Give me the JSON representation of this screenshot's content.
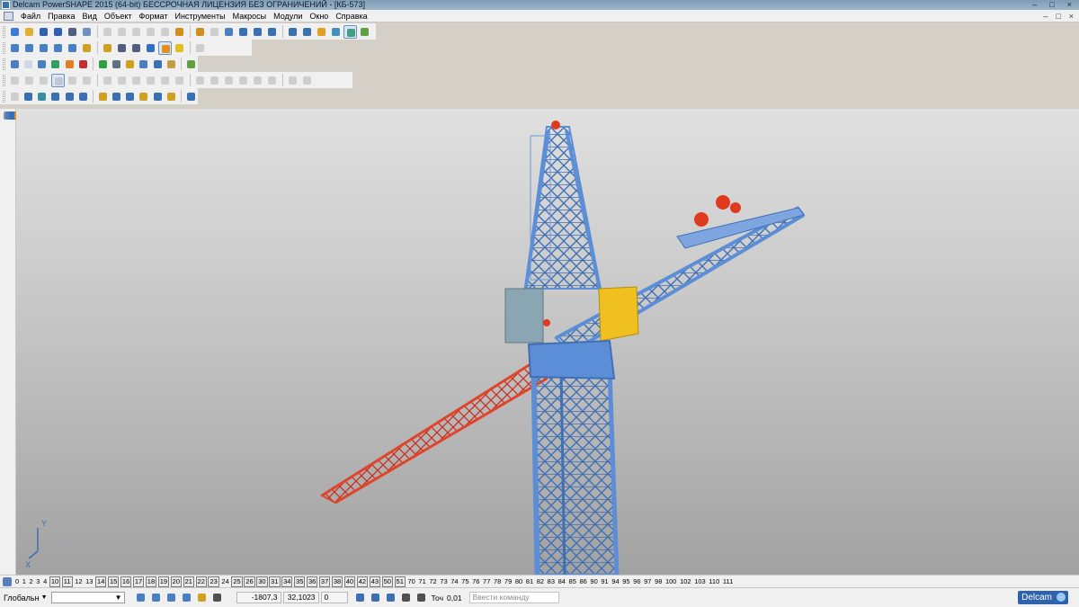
{
  "window": {
    "title": "Delcam PowerSHAPE 2015 (64-bit) БЕССРОЧНАЯ ЛИЦЕНЗИЯ БЕЗ ОГРАНИЧЕНИЙ - [КБ-573]",
    "controls": [
      "–",
      "□",
      "×"
    ],
    "mdi_controls": [
      "–",
      "□",
      "×"
    ]
  },
  "menu": [
    "Файл",
    "Правка",
    "Вид",
    "Объект",
    "Формат",
    "Инструменты",
    "Макросы",
    "Модули",
    "Окно",
    "Справка"
  ],
  "toolbars": {
    "row1": [
      {
        "icon": "new-model-icon",
        "color": "#3b7bd6"
      },
      {
        "icon": "open-icon",
        "color": "#e0b030"
      },
      {
        "icon": "save-icon",
        "color": "#3060b0"
      },
      {
        "icon": "save-as-icon",
        "color": "#3060b0"
      },
      {
        "icon": "print-icon",
        "color": "#506080"
      },
      {
        "icon": "undo-history-icon",
        "color": "#7090c0"
      },
      {
        "icon": "cut-icon",
        "color": "#909090",
        "dim": true
      },
      {
        "icon": "copy-icon",
        "color": "#909090",
        "dim": true
      },
      {
        "icon": "paste-icon",
        "color": "#909090",
        "dim": true
      },
      {
        "icon": "edit-icon",
        "color": "#909090",
        "dim": true
      },
      {
        "icon": "delete-icon",
        "color": "#909090",
        "dim": true
      },
      {
        "icon": "undo-icon",
        "color": "#d09020"
      },
      {
        "icon": "redo-icon",
        "color": "#d09020"
      },
      {
        "icon": "measure-icon",
        "color": "#909090",
        "dim": true
      },
      {
        "icon": "select-icon",
        "color": "#4a7fc0"
      },
      {
        "icon": "line-icon",
        "color": "#3a6fb0"
      },
      {
        "icon": "arc-icon",
        "color": "#3a6fb0"
      },
      {
        "icon": "circle-icon",
        "color": "#3a6fb0"
      },
      {
        "icon": "curve-icon",
        "color": "#3a6fb0"
      },
      {
        "icon": "text-icon",
        "color": "#3a6fb0"
      },
      {
        "icon": "surface-icon",
        "color": "#e0a020"
      },
      {
        "icon": "solid-icon",
        "color": "#4090c0"
      },
      {
        "icon": "shaded-icon",
        "color": "#40a080",
        "selected": true
      },
      {
        "icon": "tools-icon",
        "color": "#60a040"
      }
    ],
    "row2": [
      {
        "icon": "view-top-icon",
        "color": "#4a7fc0"
      },
      {
        "icon": "view-front-icon",
        "color": "#4a7fc0"
      },
      {
        "icon": "view-iso-icon",
        "color": "#4a7fc0"
      },
      {
        "icon": "view-iso2-icon",
        "color": "#4a7fc0"
      },
      {
        "icon": "view-right-icon",
        "color": "#4a7fc0"
      },
      {
        "icon": "zoom-in-icon",
        "color": "#d0a020"
      },
      {
        "icon": "zoom-out-icon",
        "color": "#d0a020"
      },
      {
        "icon": "zoom-box-icon",
        "color": "#506080"
      },
      {
        "icon": "zoom-fit-icon",
        "color": "#506080"
      },
      {
        "icon": "globe-icon",
        "color": "#3070c0"
      },
      {
        "icon": "shade-toggle-icon",
        "color": "#e09020",
        "selected": true
      },
      {
        "icon": "light-icon",
        "color": "#e0c020"
      },
      {
        "icon": "material-icon",
        "color": "#909090",
        "dim": true
      }
    ],
    "row3": [
      {
        "icon": "layer-icon",
        "color": "#4a7fc0"
      },
      {
        "icon": "document-icon",
        "color": "#d0d8e8"
      },
      {
        "icon": "bookmark-icon",
        "color": "#4a7fc0"
      },
      {
        "icon": "sphere-green-icon",
        "color": "#30a060"
      },
      {
        "icon": "sphere-orange-icon",
        "color": "#e08020"
      },
      {
        "icon": "sphere-red-icon",
        "color": "#c03030"
      },
      {
        "icon": "arrow-green-icon",
        "color": "#30a040"
      },
      {
        "icon": "arrow-icon",
        "color": "#607080"
      },
      {
        "icon": "cube-icon",
        "color": "#d0a020"
      },
      {
        "icon": "assembly-icon",
        "color": "#4a7fc0"
      },
      {
        "icon": "palette-icon",
        "color": "#3a6fb0"
      },
      {
        "icon": "tag-icon",
        "color": "#c0a040"
      },
      {
        "icon": "import-icon",
        "color": "#60a040"
      }
    ],
    "row4": [
      {
        "icon": "solid-select-icon",
        "color": "#909090",
        "dim": true
      },
      {
        "icon": "solid-block-icon",
        "color": "#909090",
        "dim": true
      },
      {
        "icon": "solid-sphere-icon",
        "color": "#909090",
        "dim": true
      },
      {
        "icon": "solid-box-icon",
        "color": "#909090",
        "dim": true,
        "selected": true
      },
      {
        "icon": "solid-cylinder-icon",
        "color": "#909090",
        "dim": true
      },
      {
        "icon": "solid-cone-icon",
        "color": "#909090",
        "dim": true
      },
      {
        "icon": "solid-torus-icon",
        "color": "#909090",
        "dim": true
      },
      {
        "icon": "solid-spring-icon",
        "color": "#909090",
        "dim": true
      },
      {
        "icon": "solid-extrude-icon",
        "color": "#909090",
        "dim": true
      },
      {
        "icon": "solid-spin-icon",
        "color": "#909090",
        "dim": true
      },
      {
        "icon": "solid-boolean-icon",
        "color": "#909090",
        "dim": true
      },
      {
        "icon": "solid-fillet-icon",
        "color": "#909090",
        "dim": true
      },
      {
        "icon": "solid-chamfer-icon",
        "color": "#909090",
        "dim": true
      },
      {
        "icon": "solid-shell-icon",
        "color": "#909090",
        "dim": true
      },
      {
        "icon": "solid-cut-icon",
        "color": "#909090",
        "dim": true
      },
      {
        "icon": "solid-hole-icon",
        "color": "#909090",
        "dim": true
      },
      {
        "icon": "solid-draft-icon",
        "color": "#909090",
        "dim": true
      },
      {
        "icon": "solid-offset-icon",
        "color": "#909090",
        "dim": true
      },
      {
        "icon": "solid-mirror-icon",
        "color": "#909090",
        "dim": true
      },
      {
        "icon": "solid-pattern-icon",
        "color": "#909090",
        "dim": true
      }
    ],
    "row5": [
      {
        "icon": "feature-icon",
        "color": "#909090",
        "dim": true
      },
      {
        "icon": "xy-plane-icon",
        "color": "#3a6fb0"
      },
      {
        "icon": "surface-plane-icon",
        "color": "#3a90a0"
      },
      {
        "icon": "surface-block-icon",
        "color": "#3a6fb0"
      },
      {
        "icon": "surface-sphere-icon",
        "color": "#3a6fb0"
      },
      {
        "icon": "surface-cylinder-icon",
        "color": "#3a6fb0"
      },
      {
        "icon": "surface-cone-icon",
        "color": "#d0a020"
      },
      {
        "icon": "surface-torus-icon",
        "color": "#3a6fb0"
      },
      {
        "icon": "surface-spring-icon",
        "color": "#3a6fb0"
      },
      {
        "icon": "surface-extrude-icon",
        "color": "#d0a020"
      },
      {
        "icon": "surface-spin-icon",
        "color": "#3a6fb0"
      },
      {
        "icon": "surface-loft-icon",
        "color": "#d0a020"
      },
      {
        "icon": "surface-edit-icon",
        "color": "#3a6fb0"
      }
    ],
    "left": [
      {
        "icon": "pointer-icon",
        "color": "#909090"
      },
      {
        "icon": "pan-icon",
        "color": "#4a7fc0"
      },
      {
        "icon": "rotate-view-icon",
        "color": "#4a7fc0"
      },
      {
        "icon": "wire-block-icon",
        "color": "#3a6fb0"
      },
      {
        "icon": "wire-copy-icon",
        "color": "#3a6fb0"
      },
      {
        "icon": "wire-duplicate-icon",
        "color": "#3a6fb0"
      },
      {
        "icon": "wire-transform-icon",
        "color": "#e09020"
      },
      {
        "icon": "surface-tool-icon",
        "color": "#e0a020"
      },
      {
        "icon": "plane-tool-icon",
        "color": "#3a6fb0"
      },
      {
        "icon": "print-model-icon",
        "color": "#e0a020"
      },
      {
        "icon": "scale-tool-icon",
        "color": "#3a6fb0"
      },
      {
        "icon": "shading-tool-icon",
        "color": "#3a6fb0"
      },
      {
        "icon": "solid-tool-icon",
        "color": "#3a6fb0"
      },
      {
        "icon": "box-tool-icon",
        "color": "#3a6fb0"
      },
      {
        "icon": "offset-tool-icon",
        "color": "#d0a020"
      },
      {
        "icon": "drawing-tool-icon",
        "color": "#d0a020"
      },
      {
        "icon": "color-wheel-icon",
        "color": "#d06030"
      },
      {
        "icon": "settings-tool-icon",
        "color": "#3a6fb0"
      }
    ]
  },
  "viewport": {
    "model_name": "КБ-573",
    "axis_labels": {
      "y": "Y",
      "x": "X",
      "z": "Z"
    }
  },
  "levels": [
    {
      "n": "0",
      "used": false
    },
    {
      "n": "1",
      "used": false
    },
    {
      "n": "2",
      "used": false
    },
    {
      "n": "3",
      "used": false
    },
    {
      "n": "4",
      "used": false
    },
    {
      "n": "10",
      "used": true
    },
    {
      "n": "11",
      "used": true
    },
    {
      "n": "12",
      "used": false
    },
    {
      "n": "13",
      "used": false
    },
    {
      "n": "14",
      "used": true
    },
    {
      "n": "15",
      "used": true
    },
    {
      "n": "16",
      "used": true
    },
    {
      "n": "17",
      "used": true
    },
    {
      "n": "18",
      "used": true
    },
    {
      "n": "19",
      "used": true
    },
    {
      "n": "20",
      "used": true
    },
    {
      "n": "21",
      "used": true
    },
    {
      "n": "22",
      "used": true
    },
    {
      "n": "23",
      "used": true
    },
    {
      "n": "24",
      "used": false
    },
    {
      "n": "25",
      "used": true
    },
    {
      "n": "26",
      "used": true
    },
    {
      "n": "30",
      "used": true
    },
    {
      "n": "31",
      "used": true
    },
    {
      "n": "34",
      "used": true
    },
    {
      "n": "35",
      "used": true
    },
    {
      "n": "36",
      "used": true
    },
    {
      "n": "37",
      "used": true
    },
    {
      "n": "38",
      "used": true
    },
    {
      "n": "40",
      "used": true
    },
    {
      "n": "42",
      "used": true
    },
    {
      "n": "43",
      "used": true
    },
    {
      "n": "50",
      "used": true
    },
    {
      "n": "51",
      "used": true
    },
    {
      "n": "70",
      "used": false
    },
    {
      "n": "71",
      "used": false
    },
    {
      "n": "72",
      "used": false
    },
    {
      "n": "73",
      "used": false
    },
    {
      "n": "74",
      "used": false
    },
    {
      "n": "75",
      "used": false
    },
    {
      "n": "76",
      "used": false
    },
    {
      "n": "77",
      "used": false
    },
    {
      "n": "78",
      "used": false
    },
    {
      "n": "79",
      "used": false
    },
    {
      "n": "80",
      "used": false
    },
    {
      "n": "81",
      "used": false
    },
    {
      "n": "82",
      "used": false
    },
    {
      "n": "83",
      "used": false
    },
    {
      "n": "84",
      "used": false
    },
    {
      "n": "85",
      "used": false
    },
    {
      "n": "86",
      "used": false
    },
    {
      "n": "90",
      "used": false
    },
    {
      "n": "91",
      "used": false
    },
    {
      "n": "94",
      "used": false
    },
    {
      "n": "95",
      "used": false
    },
    {
      "n": "96",
      "used": false
    },
    {
      "n": "97",
      "used": false
    },
    {
      "n": "98",
      "used": false
    },
    {
      "n": "100",
      "used": false
    },
    {
      "n": "102",
      "used": false
    },
    {
      "n": "103",
      "used": false
    },
    {
      "n": "110",
      "used": false
    },
    {
      "n": "111",
      "used": false
    }
  ],
  "status": {
    "workplane": "Глобальн",
    "workplane_arrow": "▼",
    "combo_arrow": "▼",
    "coord_x": "-1807,3",
    "coord_y": "32,1023",
    "coord_z": "0",
    "tolerance_label": "Точ",
    "tolerance_value": "0,01",
    "command_placeholder": "Ввести команду",
    "brand": "Delcam"
  },
  "colors": {
    "tower": "#5b8ed6",
    "tower_dark": "#3f6fb5",
    "counter_jib": "#e0442a",
    "counterweight": "#f0c020",
    "winch": "#e03a1e",
    "cab": "#8aa6b3"
  }
}
